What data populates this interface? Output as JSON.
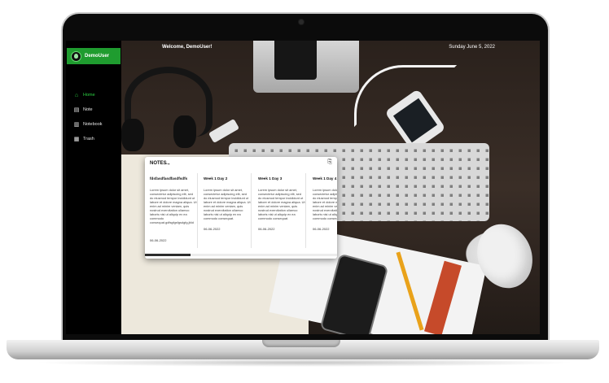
{
  "sidebar": {
    "user_name": "DemoUser",
    "items": [
      {
        "label": "Home",
        "icon": "home-icon",
        "active": true
      },
      {
        "label": "Note",
        "icon": "note-icon",
        "active": false
      },
      {
        "label": "Notebook",
        "icon": "notebook-icon",
        "active": false
      },
      {
        "label": "Trash",
        "icon": "trash-icon",
        "active": false
      }
    ]
  },
  "topbar": {
    "welcome": "Welcome, DemoUser!",
    "date": "Sunday June 5, 2022"
  },
  "notes": {
    "header": "NOTES",
    "cards": [
      {
        "title": "fdsfasdfasdfasdfsdfs",
        "body": "Lorem ipsum dolor sit amet, consectetur adipiscing elit, sed do eiusmod tempor incididunt ut labore et dolore magna aliqua. Ut enim ad minim veniam, quis nostrud exercitation ullamco laboris nisi ut aliquip ex ea commodo consequat.gdfsgfgsfgsdgfg,jfdd",
        "date": "06-06-2022"
      },
      {
        "title": "Week 1 Day 2",
        "body": "Lorem ipsum dolor sit amet, consectetur adipiscing elit, sed do eiusmod tempor incididunt ut labore et dolore magna aliqua. Ut enim ad minim veniam, quis nostrud exercitation ullamco laboris nisi ut aliquip ex ea commodo consequat.",
        "date": "06-06-2022"
      },
      {
        "title": "Week 1 Day 3",
        "body": "Lorem ipsum dolor sit amet, consectetur adipiscing elit, sed do eiusmod tempor incididunt ut labore et dolore magna aliqua. Ut enim ad minim veniam, quis nostrud exercitation ullamco laboris nisi ut aliquip ex ea commodo consequat.",
        "date": "06-06-2022"
      },
      {
        "title": "Week 1 Day 4",
        "body": "Lorem ipsum dolor sit amet, consectetur adipiscing elit, sed do eiusmod tempor incididunt ut labore et dolore magna aliqua. Ut enim ad minim veniam, quis nostrud exercitation ullamco laboris nisi ut aliquip ex ea commodo consequat.",
        "date": "06-06-2022"
      }
    ]
  },
  "colors": {
    "accent": "#1f9c2f",
    "active_nav": "#2bd142"
  }
}
